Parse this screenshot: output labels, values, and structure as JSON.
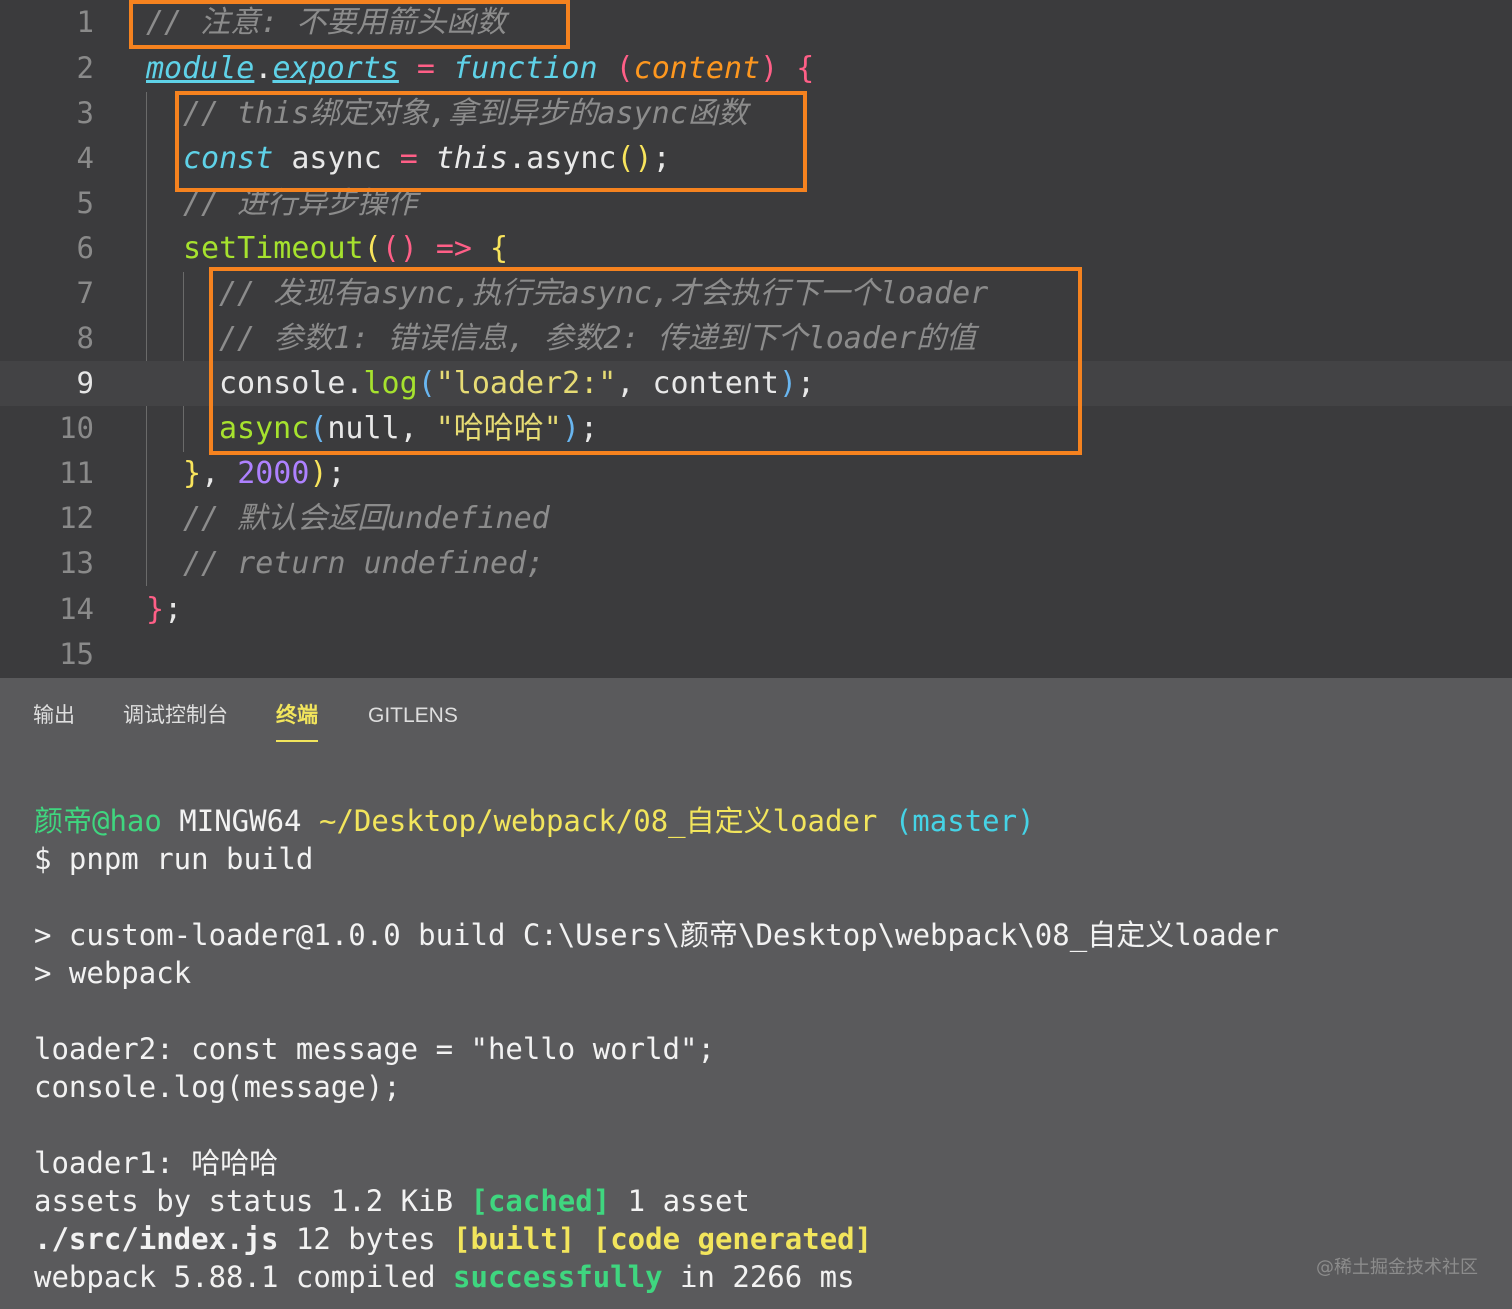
{
  "editor": {
    "line_numbers": [
      "1",
      "2",
      "3",
      "4",
      "5",
      "6",
      "7",
      "8",
      "9",
      "10",
      "11",
      "12",
      "13",
      "14",
      "15"
    ],
    "active_line": "9",
    "lines": {
      "l1": "// 注意: 不要用箭头函数",
      "l2_module": "module",
      "l2_dot": ".",
      "l2_exports": "exports",
      "l2_eq": " = ",
      "l2_function": "function",
      "l2_paren_open": " (",
      "l2_param": "content",
      "l2_paren_close": ")",
      "l2_brace": " {",
      "l3": "// this绑定对象,拿到异步的async函数",
      "l4_const": "const",
      "l4_name": " async ",
      "l4_eq": "=",
      "l4_this": " this",
      "l4_call": ".async",
      "l4_parens": "()",
      "l4_semi": ";",
      "l5": "// 进行异步操作",
      "l6_fn": "setTimeout",
      "l6_po": "(",
      "l6_args": "()",
      "l6_arrow": " =>",
      "l6_brace": " {",
      "l7": "// 发现有async,执行完async,才会执行下一个loader",
      "l8": "// 参数1: 错误信息, 参数2: 传递到下个loader的值",
      "l9_obj": "console.",
      "l9_fn": "log",
      "l9_po": "(",
      "l9_str": "\"loader2:\"",
      "l9_rest": ", content",
      "l9_pc": ")",
      "l9_semi": ";",
      "l10_fn": "async",
      "l10_po": "(",
      "l10_args": "null, ",
      "l10_str": "\"哈哈哈\"",
      "l10_pc": ")",
      "l10_semi": ";",
      "l11_brace": "}",
      "l11_comma": ", ",
      "l11_num": "2000",
      "l11_pc": ")",
      "l11_semi": ";",
      "l12": "// 默认会返回undefined",
      "l13": "// return undefined;",
      "l14_brace": "}",
      "l14_semi": ";"
    }
  },
  "panel": {
    "tabs": [
      "输出",
      "调试控制台",
      "终端",
      "GITLENS"
    ],
    "active_tab": "终端"
  },
  "terminal": {
    "prompt_user": "颜帝@hao",
    "prompt_env": " MINGW64 ",
    "prompt_path": "~/Desktop/webpack/08_自定义loader",
    "prompt_branch": " (master)",
    "command": "$ pnpm run build",
    "script_line1": "> custom-loader@1.0.0 build C:\\Users\\颜帝\\Desktop\\webpack\\08_自定义loader",
    "script_line2": "> webpack",
    "out1": "loader2: const message = \"hello world\";",
    "out2": "console.log(message);",
    "out3": "loader1: 哈哈哈",
    "assets_prefix": "assets by status 1.2 KiB ",
    "assets_cached": "[cached]",
    "assets_suffix": " 1 asset",
    "module_path": "./src/index.js",
    "module_size": " 12 bytes ",
    "module_built": "[built]",
    "module_space": " ",
    "module_generated": "[code generated]",
    "compiled_prefix": "webpack 5.88.1 compiled ",
    "compiled_status": "successfully",
    "compiled_suffix": " in 2266 ms"
  },
  "watermark": "@稀土掘金技术社区",
  "colors": {
    "highlight_box": "#f5821f",
    "terminal_green": "#3fd67f",
    "terminal_yellow": "#f2e55c",
    "terminal_cyan": "#45d3e6"
  }
}
